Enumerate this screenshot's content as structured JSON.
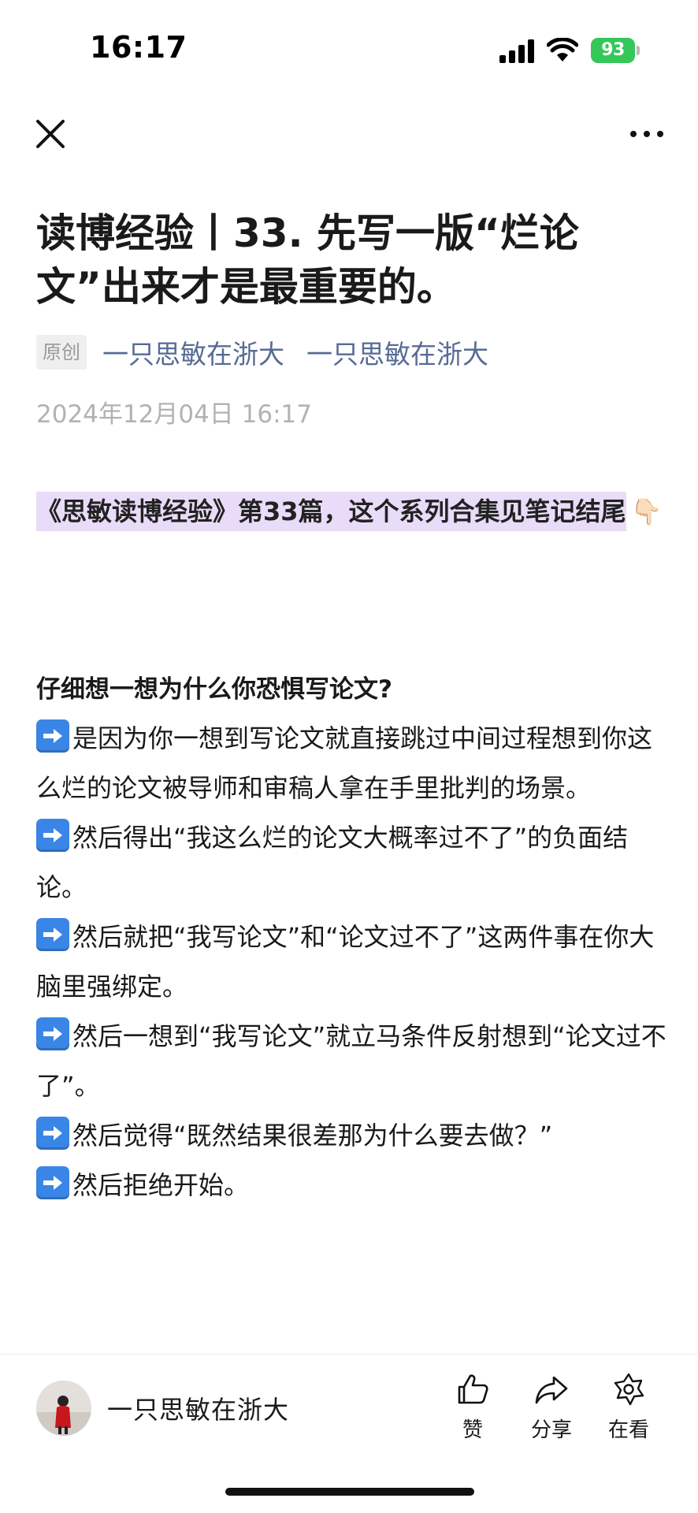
{
  "status_bar": {
    "time": "16:17",
    "battery": "93"
  },
  "nav": {
    "close_icon": "close-icon",
    "more_icon": "more-icon"
  },
  "article": {
    "title": "读博经验丨33. 先写一版“烂论文”出来才是最重要的。",
    "original_badge": "原创",
    "author_link_1": "一只思敏在浙大",
    "author_link_2": "一只思敏在浙大",
    "publish_time": "2024年12月04日 16:17",
    "intro": "《思敏读博经验》第33篇，这个系列合集见笔记结尾",
    "intro_emoji": "👇🏻",
    "heading": "仔细想一想为什么你恐惧写论文?",
    "paragraphs": [
      "是因为你一想到写论文就直接跳过中间过程想到你这么烂的论文被导师和审稿人拿在手里批判的场景。",
      "然后得出“我这么烂的论文大概率过不了”的负面结论。",
      "然后就把“我写论文”和“论文过不了”这两件事在你大脑里强绑定。",
      "然后一想到“我写论文”就立马条件反射想到“论文过不了”。",
      "然后觉得“既然结果很差那为什么要去做？”",
      "然后拒绝开始。"
    ]
  },
  "bottom_bar": {
    "author_name": "一只思敏在浙大",
    "like_label": "赞",
    "share_label": "分享",
    "watching_label": "在看"
  },
  "colors": {
    "link": "#576b95",
    "highlight": "#e9dcf8",
    "battery": "#34c759",
    "arrow_icon": "#3a86e6"
  }
}
